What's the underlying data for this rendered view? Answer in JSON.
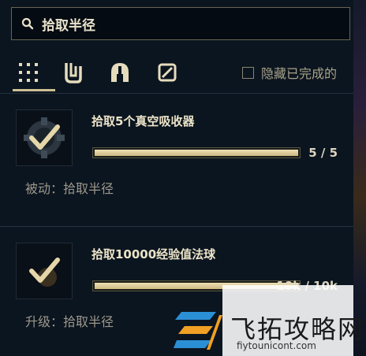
{
  "search": {
    "value": "拾取半径",
    "placeholder": ""
  },
  "tabs": [
    {
      "name": "all",
      "icon": "grid-icon"
    },
    {
      "name": "items",
      "icon": "clip-icon"
    },
    {
      "name": "helmet",
      "icon": "helmet-icon"
    },
    {
      "name": "misc",
      "icon": "slash-box-icon"
    }
  ],
  "filter": {
    "hide_completed_label": "隐藏已完成的"
  },
  "quests": [
    {
      "title": "拾取5个真空吸收器",
      "progress": 1.0,
      "count": "5 / 5",
      "description": "被动：拾取半径"
    },
    {
      "title": "拾取10000经验值法球",
      "progress": 1.0,
      "count": "10k / 10k",
      "description": "升级：拾取半径"
    }
  ],
  "watermark": {
    "name": "飞拓攻略网",
    "url": "fiytounicont.com"
  },
  "colors": {
    "accent": "#cdbf93",
    "background": "#0b1520"
  }
}
